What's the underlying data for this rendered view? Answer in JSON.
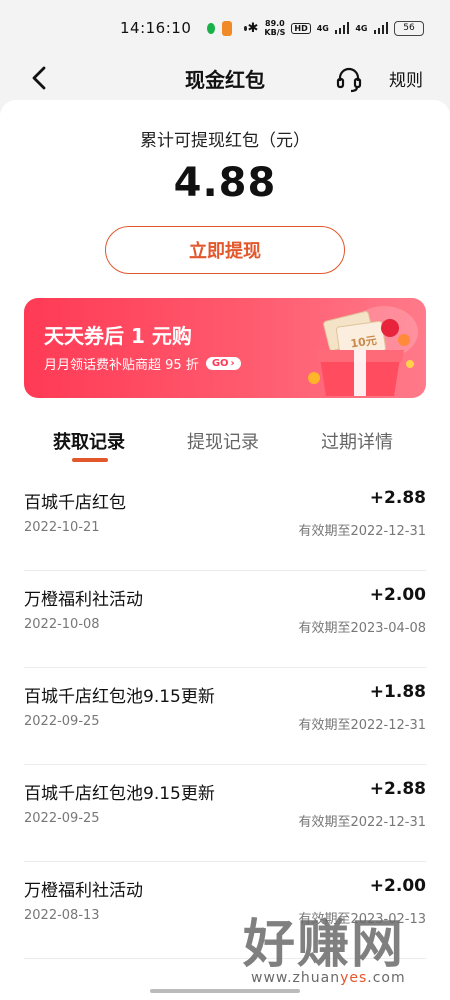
{
  "status_bar": {
    "time": "14:16:10",
    "net_speed_value": "89.0",
    "net_speed_unit": "KB/S",
    "hd_label": "HD",
    "signal1": "4G",
    "signal2": "4G",
    "battery": "56"
  },
  "header": {
    "title": "现金红包",
    "rules_label": "规则"
  },
  "balance": {
    "label": "累计可提现红包（元）",
    "amount": "4.88",
    "withdraw_label": "立即提现"
  },
  "banner": {
    "title": "天天券后 1 元购",
    "subtitle": "月月领话费补贴商超 95 折",
    "go_label": "GO",
    "coupon_text": "10元"
  },
  "tabs": [
    {
      "label": "获取记录",
      "active": true
    },
    {
      "label": "提现记录",
      "active": false
    },
    {
      "label": "过期详情",
      "active": false
    }
  ],
  "records": [
    {
      "name": "百城千店红包",
      "amount": "+2.88",
      "date": "2022-10-21",
      "expiry": "有效期至2022-12-31"
    },
    {
      "name": "万橙福利社活动",
      "amount": "+2.00",
      "date": "2022-10-08",
      "expiry": "有效期至2023-04-08"
    },
    {
      "name": "百城千店红包池9.15更新",
      "amount": "+1.88",
      "date": "2022-09-25",
      "expiry": "有效期至2022-12-31"
    },
    {
      "name": "百城千店红包池9.15更新",
      "amount": "+2.88",
      "date": "2022-09-25",
      "expiry": "有效期至2022-12-31"
    },
    {
      "name": "万橙福利社活动",
      "amount": "+2.00",
      "date": "2022-08-13",
      "expiry": "有效期至2023-02-13"
    }
  ],
  "watermark": {
    "big_text": "好赚网",
    "url_prefix": "www.zhuan",
    "url_highlight": "yes",
    "url_suffix": ".com"
  },
  "colors": {
    "accent": "#e2572b",
    "banner_start": "#ff3a55",
    "banner_end": "#ff7a8a"
  }
}
